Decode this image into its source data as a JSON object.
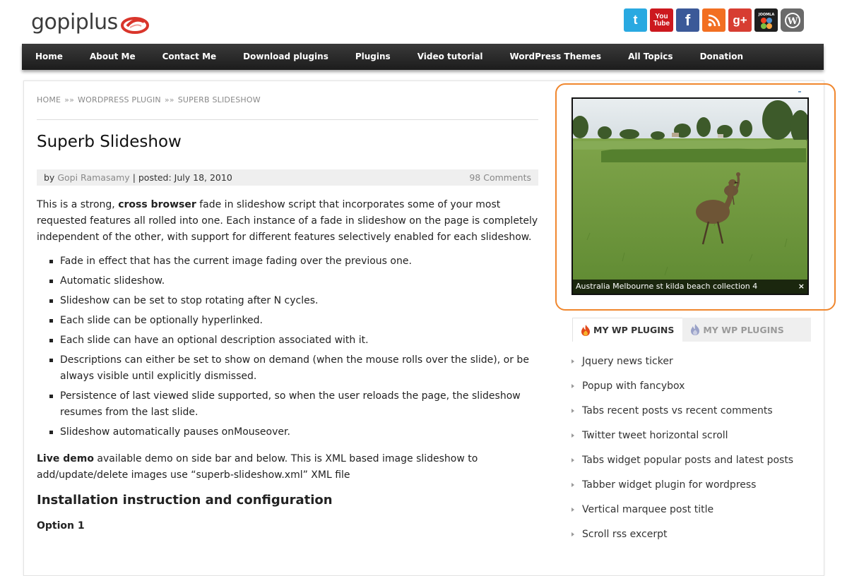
{
  "header": {
    "logo_text": "gopiplus",
    "social": {
      "twitter_glyph": "t",
      "youtube_line1": "You",
      "youtube_line2": "Tube",
      "facebook_glyph": "f",
      "gplus_glyph": "g+",
      "joomla_label": "JOOMLA",
      "wordpress_glyph": "W"
    }
  },
  "nav": {
    "items": [
      "Home",
      "About Me",
      "Contact Me",
      "Download plugins",
      "Plugins",
      "Video tutorial",
      "WordPress Themes",
      "All Topics",
      "Donation"
    ]
  },
  "breadcrumb": {
    "home": "HOME",
    "sep": "»»",
    "category": "WORDPRESS PLUGIN",
    "current": "SUPERB SLIDESHOW"
  },
  "post": {
    "title": "Superb Slideshow",
    "meta": {
      "by": "by",
      "author": "Gopi Ramasamy",
      "posted": "| posted: July 18, 2010",
      "comments": "98 Comments"
    },
    "intro_before": "This is a strong,",
    "intro_bold": "cross browser",
    "intro_after": "fade in slideshow script that incorporates some of your most requested features all rolled into one. Each instance of a fade in slideshow on the page is completely independent of the other, with support for different features selectively enabled for each slideshow.",
    "features": [
      "Fade in effect that has the current image fading over the previous one.",
      "Automatic slideshow.",
      "Slideshow can be set to stop rotating after N cycles.",
      "Each slide can be optionally hyperlinked.",
      "Each slide can have an optional description associated with it.",
      "Descriptions can either be set to show on demand (when the mouse rolls over the slide), or be always visible until explicitly dismissed.",
      "Persistence of last viewed slide supported, so when the user reloads the page, the slideshow resumes from the last slide.",
      "Slideshow automatically pauses onMouseover."
    ],
    "demo_bold": "Live demo",
    "demo_text": "available demo on side bar and below. This is XML based image slideshow to add/update/delete images use “superb-slideshow.xml” XML file",
    "install_heading": "Installation instruction and configuration",
    "option_heading": "Option 1"
  },
  "sidebar": {
    "slide_caption": "Australia Melbourne st kilda beach collection 4",
    "slide_close": "×",
    "tabs": [
      "MY WP PLUGINS",
      "MY WP PLUGINS"
    ],
    "plugins": [
      "Jquery news ticker",
      "Popup with fancybox",
      "Tabs recent posts vs recent comments",
      "Twitter tweet horizontal scroll",
      "Tabs widget popular posts and latest posts",
      "Tabber widget plugin for wordpress",
      "Vertical marquee post title",
      "Scroll rss excerpt"
    ]
  },
  "colors": {
    "nav_bg": "#2a2a2a",
    "highlight": "#f0872e",
    "logo_swirl": "#d9352b"
  }
}
